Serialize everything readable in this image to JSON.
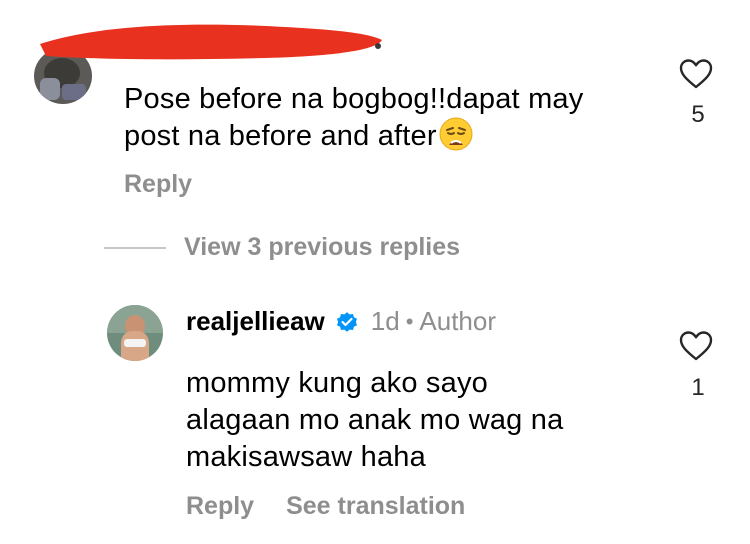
{
  "top_comment": {
    "text_line1": "Pose before na bogbog!!dapat may",
    "text_line2": "post na before and after",
    "emoji": "weary-face-emoji",
    "reply_label": "Reply",
    "like_count": "5"
  },
  "view_replies_label": "View 3 previous replies",
  "reply_comment": {
    "username": "realjellieaw",
    "time": "1d",
    "separator": "•",
    "author_label": "Author",
    "text_line1": "mommy kung ako sayo",
    "text_line2": "alagaan mo anak mo wag na",
    "text_line3": "makisawsaw haha",
    "reply_label": "Reply",
    "see_translation_label": "See translation",
    "like_count": "1"
  },
  "colors": {
    "redaction": "#e8321f",
    "secondary_text": "#8e8e8e",
    "verified_blue": "#0095f6"
  }
}
